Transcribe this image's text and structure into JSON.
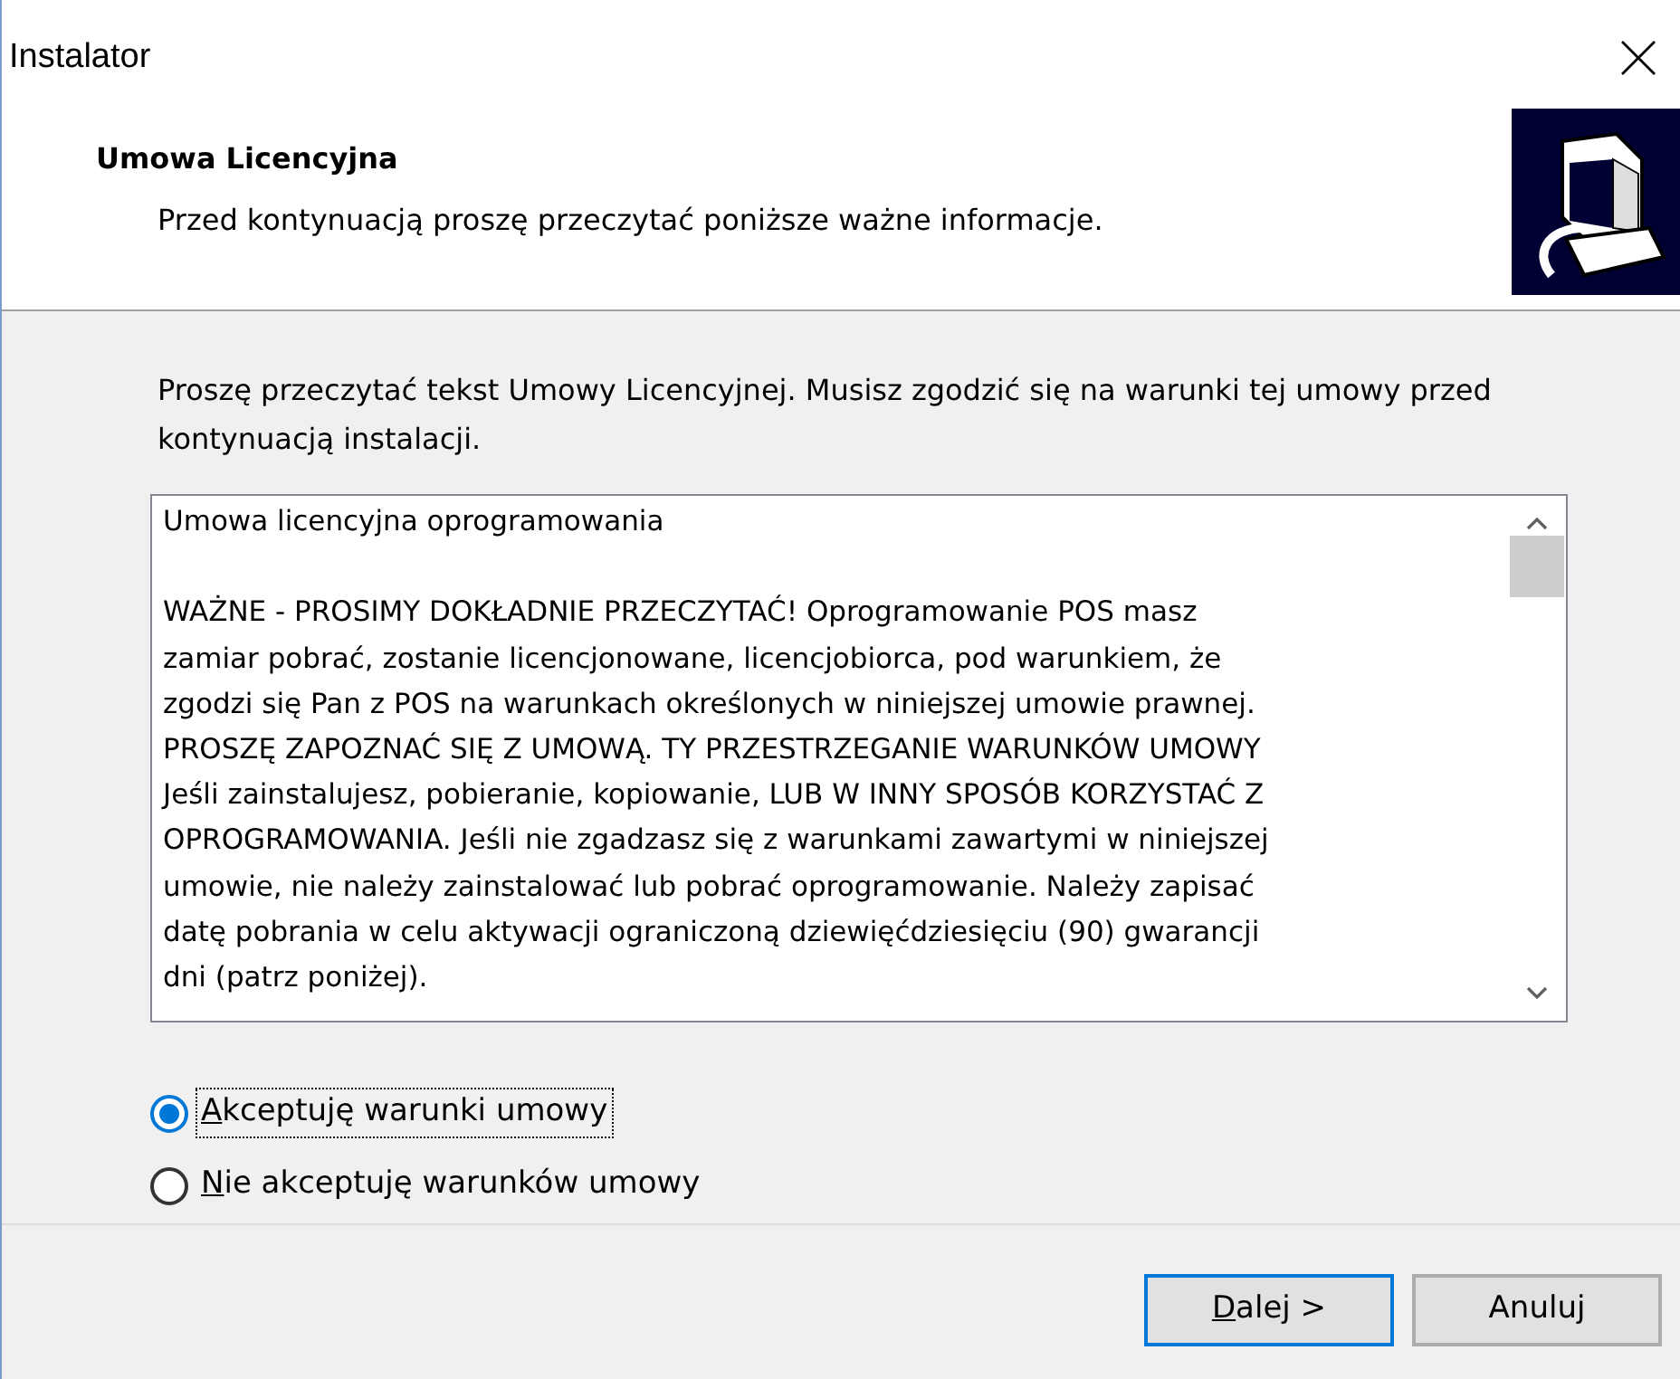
{
  "window": {
    "title": "Instalator"
  },
  "header": {
    "title": "Umowa Licencyjna",
    "subtitle": "Przed kontynuacją proszę przeczytać poniższe ważne informacje."
  },
  "intro": "Proszę przeczytać tekst Umowy Licencyjnej. Musisz zgodzić się na warunki tej umowy przed kontynuacją instalacji.",
  "license_text": {
    "paragraphs": [
      [
        "Umowa licencyjna oprogramowania"
      ],
      [
        "WAŻNE - PROSIMY DOKŁADNIE PRZECZYTAĆ! Oprogramowanie POS masz",
        "zamiar pobrać, zostanie licencjonowane, licencjobiorca, pod warunkiem, że",
        "zgodzi się Pan z POS na warunkach określonych w niniejszej umowie prawnej.",
        "PROSZĘ ZAPOZNAĆ SIĘ Z UMOWĄ. TY PRZESTRZEGANIE WARUNKÓW UMOWY",
        "Jeśli zainstalujesz, pobieranie, kopiowanie, LUB W INNY SPOSÓB KORZYSTAĆ Z",
        "OPROGRAMOWANIA. Jeśli nie zgadzasz się z warunkami zawartymi w niniejszej",
        "umowie, nie należy zainstalować lub pobrać oprogramowanie. Należy zapisać",
        "datę pobrania w celu aktywacji ograniczoną dziewięćdziesięciu (90) gwarancji",
        "dni (patrz poniżej)."
      ]
    ]
  },
  "options": [
    {
      "label": "Akceptuję warunki umowy",
      "selected": true,
      "focused": true,
      "access_key_underlined": true
    },
    {
      "label": "Nie akceptuję warunków umowy",
      "selected": false,
      "focused": false,
      "access_key_underlined": true
    }
  ],
  "buttons": [
    {
      "label": "Dalej >",
      "default": true,
      "access_key_underlined": true
    },
    {
      "label": "Anuluj",
      "default": false,
      "access_key_underlined": false
    }
  ]
}
